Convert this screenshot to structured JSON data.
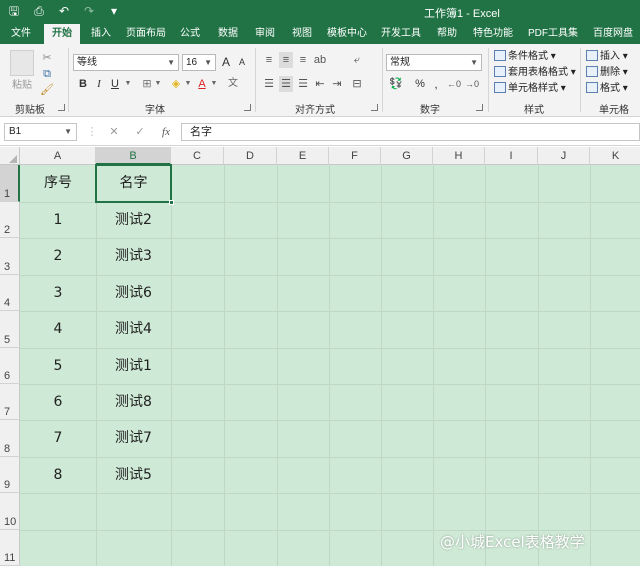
{
  "titlebar": {
    "title": "工作簿1 - Excel",
    "qat": [
      {
        "name": "save-icon",
        "glyph": "🖫"
      },
      {
        "name": "print-preview-icon",
        "glyph": "⎙"
      },
      {
        "name": "undo-icon",
        "glyph": "↶"
      },
      {
        "name": "redo-icon",
        "glyph": "↷"
      },
      {
        "name": "customize-qat-icon",
        "glyph": "▾"
      }
    ]
  },
  "tabs": [
    "文件",
    "开始",
    "插入",
    "页面布局",
    "公式",
    "数据",
    "审阅",
    "视图",
    "模板中心",
    "开发工具",
    "帮助",
    "特色功能",
    "PDF工具集",
    "百度网盘"
  ],
  "active_tab": "开始",
  "ribbon": {
    "clipboard": {
      "paste_label": "粘贴",
      "group_label": "剪贴板"
    },
    "font": {
      "font_name": "等线",
      "font_size": "16",
      "bold": "B",
      "italic": "I",
      "underline": "U",
      "grow": "A",
      "shrink": "A",
      "group_label": "字体"
    },
    "alignment": {
      "group_label": "对齐方式"
    },
    "number": {
      "format": "常规",
      "percent": "%",
      "group_label": "数字"
    },
    "styles": {
      "items": [
        "条件格式",
        "套用表格格式",
        "单元格样式"
      ],
      "group_label": "样式"
    },
    "cells": {
      "items": [
        "插入",
        "删除",
        "格式"
      ],
      "group_label": "单元格"
    }
  },
  "formula_bar": {
    "name_box": "B1",
    "cancel": "✕",
    "enter": "✓",
    "fx": "fx",
    "value": "名字"
  },
  "columns": [
    "A",
    "B",
    "C",
    "D",
    "E",
    "F",
    "G",
    "H",
    "I",
    "J",
    "K"
  ],
  "selected_column": "B",
  "rows": [
    "1",
    "2",
    "3",
    "4",
    "5",
    "6",
    "7",
    "8",
    "9",
    "10",
    "11"
  ],
  "table": {
    "headers": [
      "序号",
      "名字"
    ],
    "rows": [
      [
        "1",
        "测试2"
      ],
      [
        "2",
        "测试3"
      ],
      [
        "3",
        "测试6"
      ],
      [
        "4",
        "测试4"
      ],
      [
        "5",
        "测试1"
      ],
      [
        "6",
        "测试8"
      ],
      [
        "7",
        "测试7"
      ],
      [
        "8",
        "测试5"
      ]
    ]
  },
  "watermark": "@小城Excel表格教学",
  "colors": {
    "accent": "#217346",
    "sheet_bg": "#cee9d5"
  }
}
